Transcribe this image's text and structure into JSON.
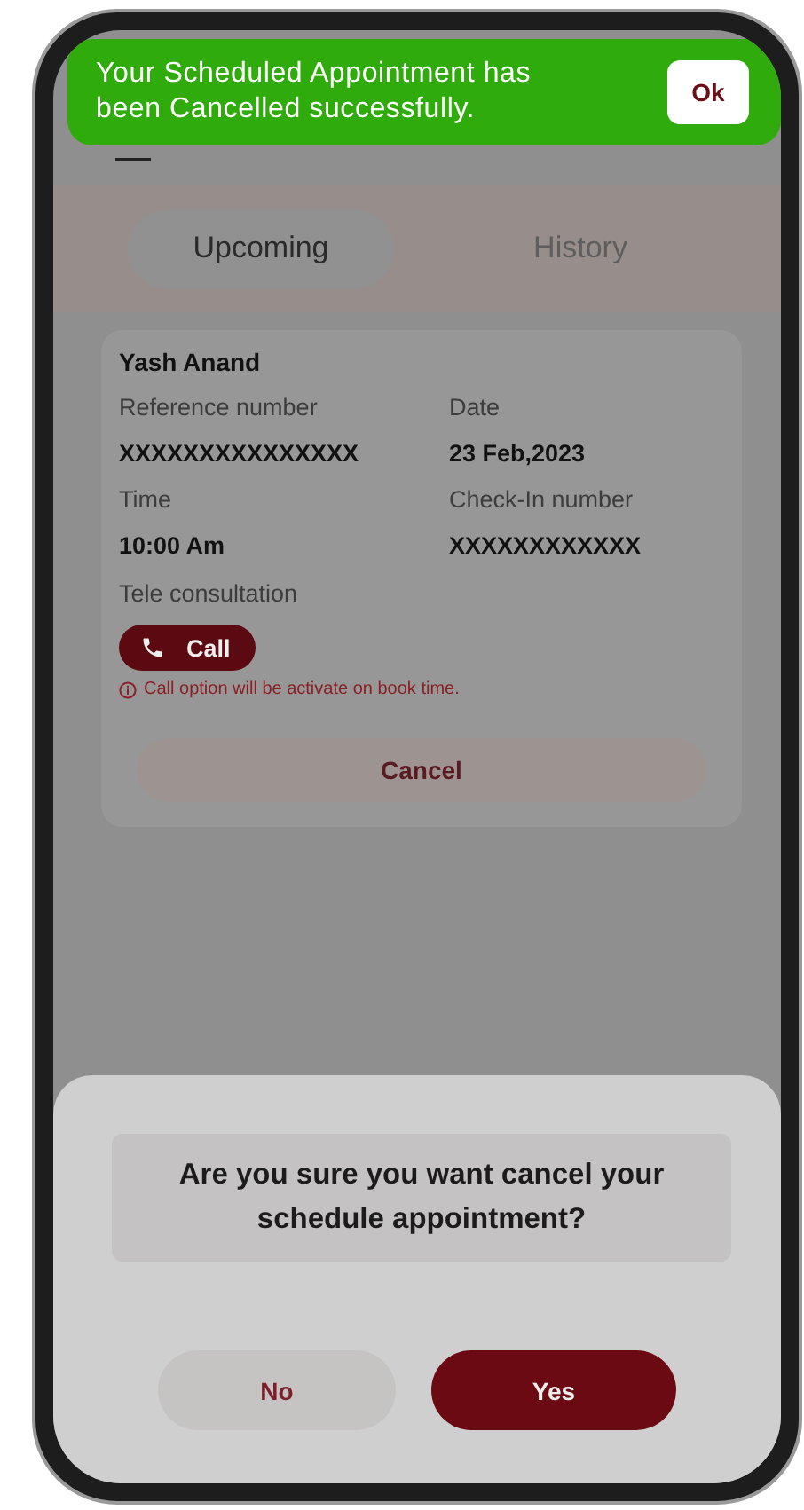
{
  "toast": {
    "message": "Your Scheduled Appointment has been Cancelled successfully.",
    "button": "Ok"
  },
  "tabs": [
    {
      "label": "Upcoming",
      "selected": true
    },
    {
      "label": "History",
      "selected": false
    }
  ],
  "appointment": {
    "patient": "Yash Anand",
    "fields": [
      {
        "label": "Reference number",
        "value": "XXXXXXXXXXXXXXX"
      },
      {
        "label": "Date",
        "value": "23 Feb,2023"
      },
      {
        "label": "Time",
        "value": "10:00 Am"
      },
      {
        "label": "Check-In number",
        "value": "XXXXXXXXXXXX"
      }
    ],
    "consultation_type": "Tele consultation",
    "call_button": "Call",
    "notice": "Call option will be activate on book time.",
    "cancel_button": "Cancel"
  },
  "dialog": {
    "question": "Are you sure you want cancel your schedule appointment?",
    "buttons": [
      {
        "label": "No",
        "kind": "secondary"
      },
      {
        "label": "Yes",
        "kind": "primary"
      }
    ]
  }
}
